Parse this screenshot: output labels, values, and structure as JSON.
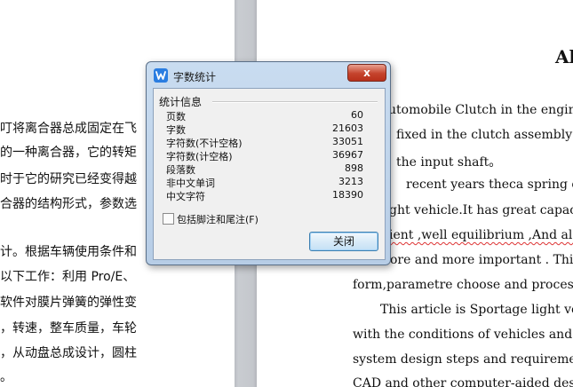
{
  "left_page": {
    "lines": [
      "叮将离合器总成固定在飞",
      "的一种离合器，它的转矩",
      "时于它的研究已经变得越",
      "合器的结构形式，参数选",
      "计。根据车辆使用条件和",
      "以下工作：利用 Pro/E、",
      "软件对膜片弹簧的弹性变",
      "，转速，整车质量，车轮",
      "，从动盘总成设计，圆柱",
      "。"
    ]
  },
  "right_page": {
    "heading": "Al",
    "lines": [
      "utomobile Clutch in the engine",
      "fixed in the clutch assembly af",
      "the input shaft。",
      "recent years theca spring clut",
      "ght vehicle.It has great capacity",
      "ient ,well equilibrium ,And also",
      "ore and more important . This",
      "form,parametre choose and process of",
      "This article is Sportage light vehi",
      "with the conditions of vehicles and",
      "system design steps and requirements,",
      "CAD and other computer-aided desig"
    ]
  },
  "dialog": {
    "title": "字数统计",
    "close_glyph": "x",
    "group_title": "统计信息",
    "stats": [
      {
        "label": "页数",
        "value": "60"
      },
      {
        "label": "字数",
        "value": "21603"
      },
      {
        "label": "字符数(不计空格)",
        "value": "33051"
      },
      {
        "label": "字符数(计空格)",
        "value": "36967"
      },
      {
        "label": "段落数",
        "value": "898"
      },
      {
        "label": "非中文单词",
        "value": "3213"
      },
      {
        "label": "中文字符",
        "value": "18390"
      }
    ],
    "checkbox_label": "包括脚注和尾注(F)",
    "close_button": "关闭"
  },
  "colors": {
    "accent": "#2a7de1",
    "close_button": "#c5432c"
  }
}
